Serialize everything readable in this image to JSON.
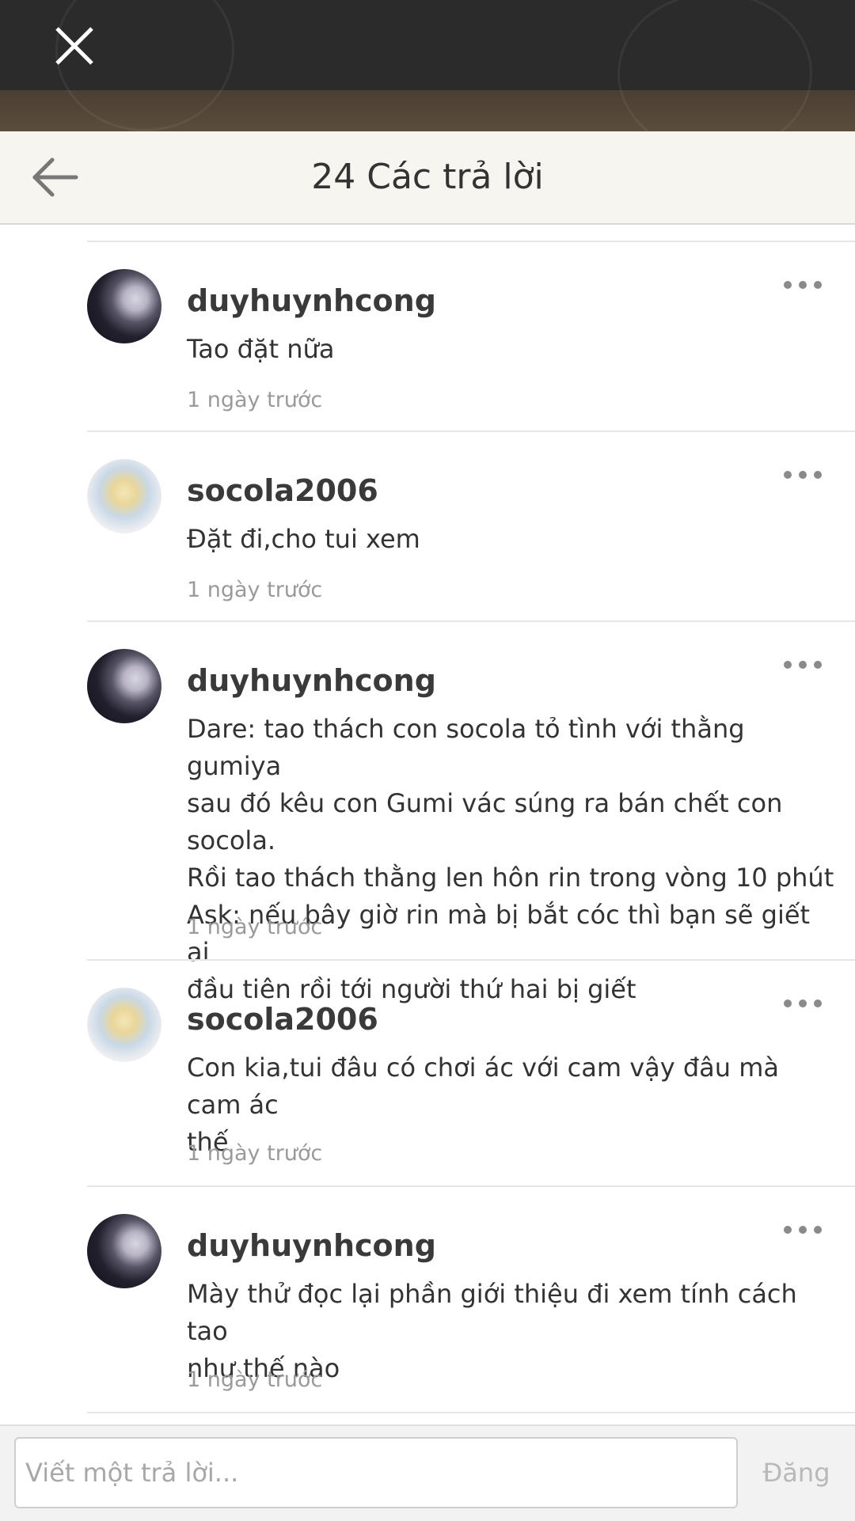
{
  "header": {
    "title": "24 Các trả lời"
  },
  "icons": {
    "close": "close-icon",
    "back": "arrow-left-icon",
    "more": "more-horizontal-icon"
  },
  "comments": [
    {
      "username": "duyhuynhcong",
      "text": "Tao đặt nữa",
      "time": "1 ngày trước"
    },
    {
      "username": "socola2006",
      "text": "Đặt đi,cho tui xem",
      "time": "1 ngày trước"
    },
    {
      "username": "duyhuynhcong",
      "lines": [
        "Dare: tao thách con socola tỏ tình với thằng gumiya",
        "sau đó kêu con Gumi vác súng ra bán chết con socola.",
        "Rồi tao thách thằng len hôn rin trong vòng 10 phút",
        "Ask: nếu bây giờ rin mà bị bắt cóc thì bạn sẽ giết ai",
        "đầu tiên rồi tới người thứ hai bị giết"
      ],
      "time": "1 ngày trước"
    },
    {
      "username": "socola2006",
      "lines": [
        "Con kia,tui đâu có chơi ác với cam vậy đâu mà cam ác",
        "thế"
      ],
      "time": "1 ngày trước"
    },
    {
      "username": "duyhuynhcong",
      "lines": [
        "Mày thử đọc lại phần giới thiệu đi xem tính cách tao",
        "như thế nào"
      ],
      "time": "1 ngày trước"
    }
  ],
  "reply": {
    "placeholder": "Viết một trả lời...",
    "post_label": "Đăng"
  }
}
